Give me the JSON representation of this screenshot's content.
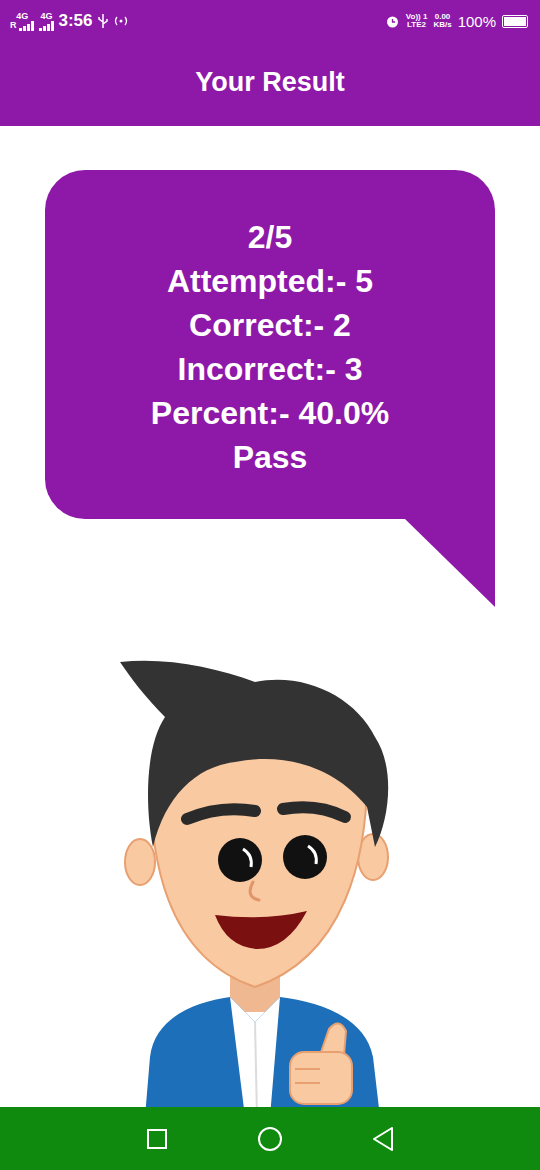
{
  "status_bar": {
    "network": "4G",
    "roaming": "R",
    "network2": "4G",
    "time": "3:56",
    "volte": "Vo)) 1",
    "volte_sim": "LTE2",
    "speed": "0.00",
    "speed_unit": "KB/s",
    "battery": "100%",
    "battery_level": 1.0
  },
  "app_bar": {
    "title": "Your Result"
  },
  "result": {
    "score": "2/5",
    "lines": [
      "Attempted:- 5",
      "Correct:- 2",
      "Incorrect:- 3",
      "Percent:- 40.0%"
    ],
    "status": "Pass"
  }
}
